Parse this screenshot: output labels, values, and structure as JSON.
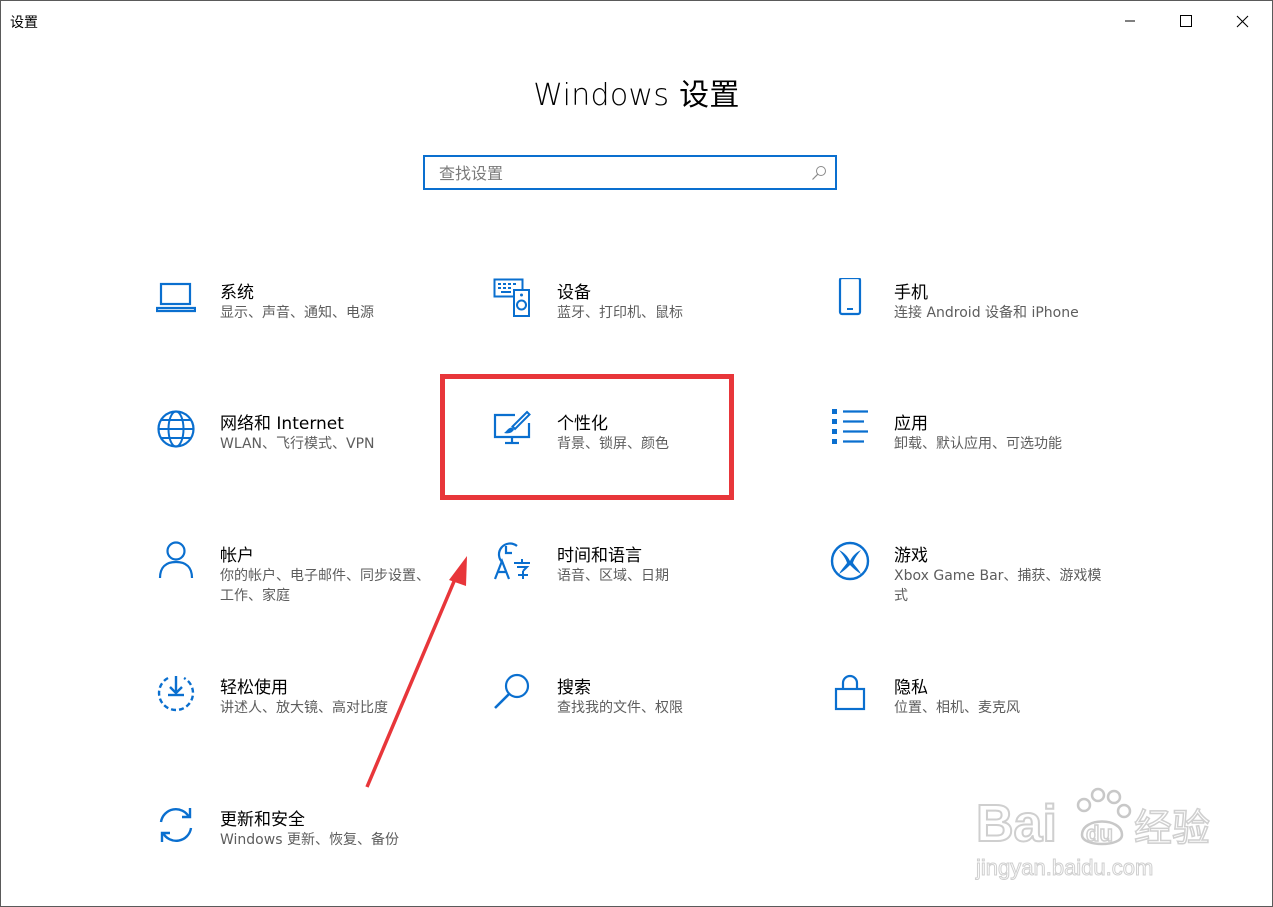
{
  "window": {
    "title": "设置",
    "controls": [
      "minimize",
      "maximize",
      "close"
    ]
  },
  "page": {
    "title": "Windows 设置"
  },
  "search": {
    "placeholder": "查找设置",
    "value": ""
  },
  "tiles": [
    {
      "id": "system",
      "title": "系统",
      "desc": "显示、声音、通知、电源",
      "icon": "laptop-icon"
    },
    {
      "id": "devices",
      "title": "设备",
      "desc": "蓝牙、打印机、鼠标",
      "icon": "keyboard-speaker-icon"
    },
    {
      "id": "phone",
      "title": "手机",
      "desc": "连接 Android 设备和 iPhone",
      "icon": "phone-icon"
    },
    {
      "id": "network",
      "title": "网络和 Internet",
      "desc": "WLAN、飞行模式、VPN",
      "icon": "globe-icon"
    },
    {
      "id": "personalization",
      "title": "个性化",
      "desc": "背景、锁屏、颜色",
      "icon": "paintbrush-monitor-icon"
    },
    {
      "id": "apps",
      "title": "应用",
      "desc": "卸载、默认应用、可选功能",
      "icon": "list-icon"
    },
    {
      "id": "accounts",
      "title": "帐户",
      "desc": "你的帐户、电子邮件、同步设置、工作、家庭",
      "icon": "person-icon"
    },
    {
      "id": "time-language",
      "title": "时间和语言",
      "desc": "语音、区域、日期",
      "icon": "clock-language-icon"
    },
    {
      "id": "gaming",
      "title": "游戏",
      "desc": "Xbox Game Bar、捕获、游戏模式",
      "icon": "xbox-icon"
    },
    {
      "id": "ease-of-access",
      "title": "轻松使用",
      "desc": "讲述人、放大镜、高对比度",
      "icon": "ease-of-access-icon"
    },
    {
      "id": "search",
      "title": "搜索",
      "desc": "查找我的文件、权限",
      "icon": "magnifier-icon"
    },
    {
      "id": "privacy",
      "title": "隐私",
      "desc": "位置、相机、麦克风",
      "icon": "lock-icon"
    },
    {
      "id": "update-security",
      "title": "更新和安全",
      "desc": "Windows 更新、恢复、备份",
      "icon": "sync-arrows-icon"
    }
  ],
  "annotation": {
    "highlight_color": "#e8363a",
    "highlight_target": "personalization"
  },
  "watermark": {
    "brand_text": "Baidu经验",
    "url_text": "jingyan.baidu.com"
  },
  "colors": {
    "accent": "#0a6fcf",
    "icon_blue": "#0a6fcf"
  }
}
